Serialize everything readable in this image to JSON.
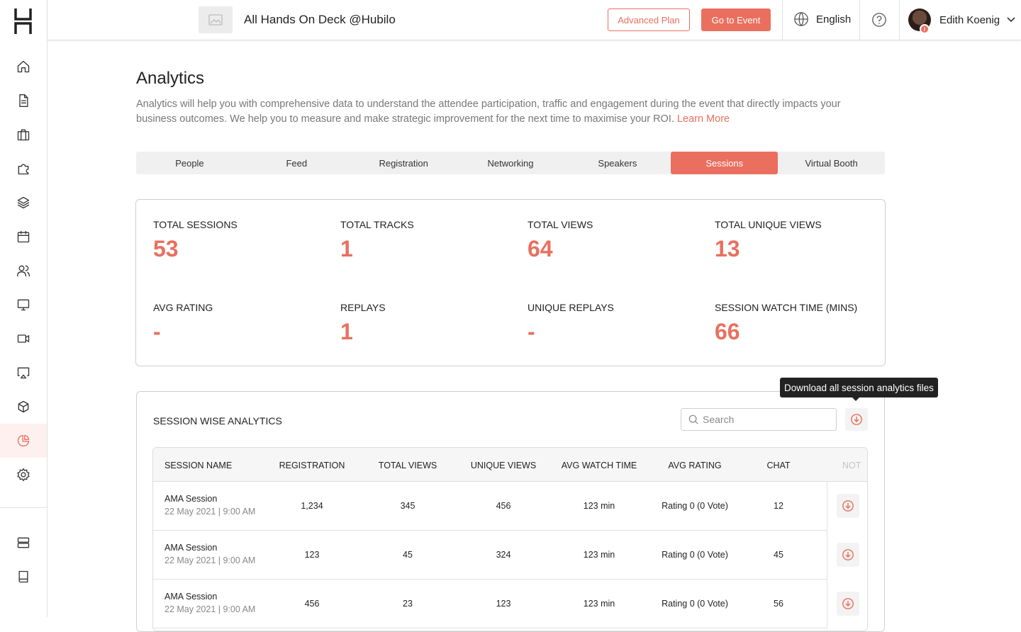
{
  "header": {
    "event_title": "All Hands On Deck @Hubilo",
    "plan_button": "Advanced Plan",
    "go_event_button": "Go to Event",
    "language": "English",
    "user_name": "Edith Koenig",
    "avatar_badge": "i"
  },
  "page": {
    "title": "Analytics",
    "description": "Analytics will help you with comprehensive data to understand the attendee participation, traffic and engagement during the event that directly impacts your business outcomes. We help you to measure and make strategic improvement for the next time to maximise your ROI.",
    "learn_more": "Learn More"
  },
  "tabs": [
    "People",
    "Feed",
    "Registration",
    "Networking",
    "Speakers",
    "Sessions",
    "Virtual Booth"
  ],
  "active_tab": "Sessions",
  "stats": [
    {
      "label": "TOTAL SESSIONS",
      "value": "53"
    },
    {
      "label": "TOTAL TRACKS",
      "value": "1"
    },
    {
      "label": "TOTAL VIEWS",
      "value": "64"
    },
    {
      "label": "TOTAL UNIQUE VIEWS",
      "value": "13"
    },
    {
      "label": "AVG RATING",
      "value": "-"
    },
    {
      "label": "REPLAYS",
      "value": "1"
    },
    {
      "label": "UNIQUE REPLAYS",
      "value": "-"
    },
    {
      "label": "SESSION WATCH TIME (MINS)",
      "value": "66"
    }
  ],
  "session_analytics": {
    "title": "SESSION WISE ANALYTICS",
    "search_placeholder": "Search",
    "tooltip": "Download all session analytics files",
    "columns": [
      "SESSION NAME",
      "REGISTRATION",
      "TOTAL VIEWS",
      "UNIQUE VIEWS",
      "AVG WATCH TIME",
      "AVG RATING",
      "CHAT",
      "NOT"
    ],
    "rows": [
      {
        "name": "AMA Session",
        "date": "22 May 2021 | 9:00 AM",
        "registration": "1,234",
        "total_views": "345",
        "unique_views": "456",
        "avg_watch_time": "123 min",
        "avg_rating": "Rating 0 (0 Vote)",
        "chat": "12"
      },
      {
        "name": "AMA Session",
        "date": "22 May 2021 | 9:00 AM",
        "registration": "123",
        "total_views": "45",
        "unique_views": "324",
        "avg_watch_time": "123 min",
        "avg_rating": "Rating 0 (0 Vote)",
        "chat": "45"
      },
      {
        "name": "AMA Session",
        "date": "22 May 2021 | 9:00 AM",
        "registration": "456",
        "total_views": "23",
        "unique_views": "123",
        "avg_watch_time": "123 min",
        "avg_rating": "Rating 0 (0 Vote)",
        "chat": "56"
      }
    ]
  },
  "sidebar": {
    "icons": [
      "home-icon",
      "document-icon",
      "briefcase-icon",
      "puzzle-icon",
      "layers-icon",
      "calendar-icon",
      "people-icon",
      "monitor-icon",
      "video-icon",
      "screencast-icon",
      "box-icon",
      "pie-chart-icon",
      "gear-icon",
      "server-icon",
      "book-icon"
    ],
    "active": "pie-chart-icon"
  },
  "colors": {
    "accent": "#ea6f5f",
    "muted_text": "#777777",
    "border": "#cfcfcf"
  }
}
